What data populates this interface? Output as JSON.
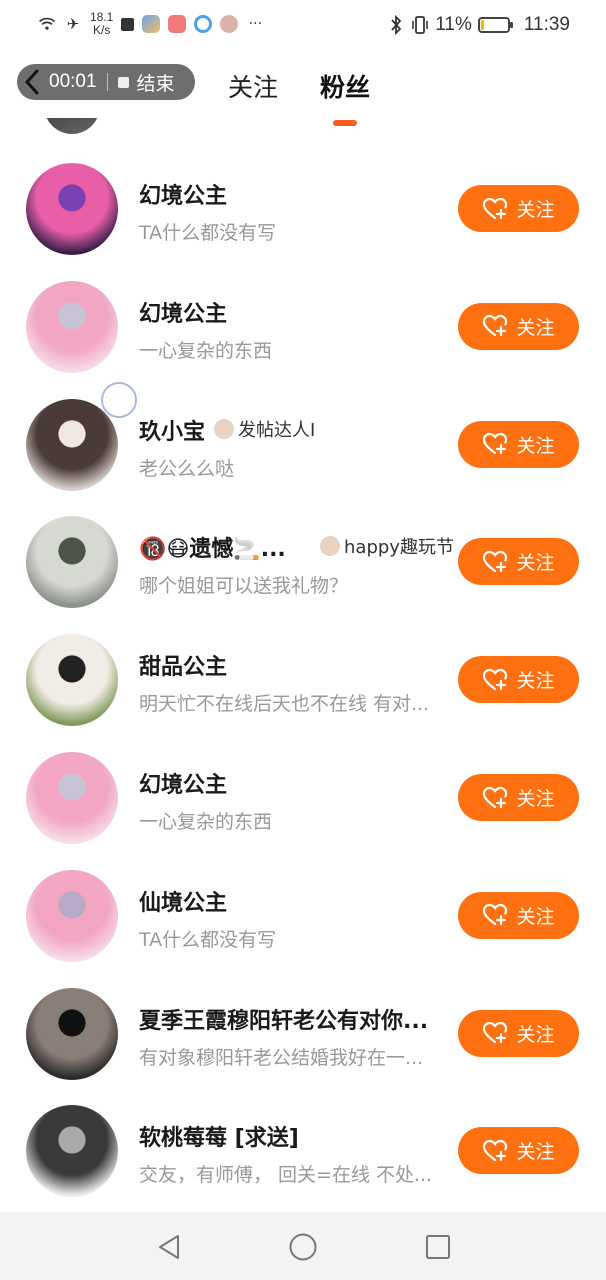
{
  "status_bar": {
    "network_speed": "18.1",
    "network_speed_unit": "K/s",
    "battery_percent": "11%",
    "time": "11:39",
    "battery_level": 0.11,
    "icons": [
      "wifi-icon",
      "airplane-icon",
      "notification-icon",
      "app-icon",
      "app-icon",
      "app-icon",
      "app-icon",
      "more-icon",
      "bluetooth-icon",
      "vibrate-icon",
      "battery-icon"
    ]
  },
  "recorder": {
    "elapsed": "00:01",
    "stop_label": "结束"
  },
  "tabs": [
    {
      "label": "关注",
      "active": false
    },
    {
      "label": "粉丝",
      "active": true
    }
  ],
  "accent_color": "#ff7010",
  "follow_label": "关注",
  "followers": [
    {
      "name": "幻境公主",
      "bio": "TA什么都没有写",
      "badge": "",
      "avatar_colors": [
        "#3a1f4a",
        "#e85fa8",
        "#7a3fb0"
      ]
    },
    {
      "name": "幻境公主",
      "bio": "一心复杂的东西",
      "badge": "",
      "avatar_colors": [
        "#f6dbe6",
        "#f2a6c4",
        "#c9c3d8"
      ]
    },
    {
      "name": "玖小宝",
      "bio": "老公么么哒",
      "badge": "发帖达人I",
      "avatar_colors": [
        "#d9cfcc",
        "#4a3a38",
        "#f0e6e2"
      ]
    },
    {
      "name": "🔞😷遗憾🚬...",
      "bio": "哪个姐姐可以送我礼物？",
      "badge": "happy趣玩节",
      "avatar_colors": [
        "#8b9088",
        "#d6d8d2",
        "#4e544a"
      ]
    },
    {
      "name": "甜品公主",
      "bio": "明天忙不在线后天也不在线 有对...",
      "badge": "",
      "avatar_colors": [
        "#7f9a5a",
        "#f1ece6",
        "#222222"
      ]
    },
    {
      "name": "幻境公主",
      "bio": "一心复杂的东西",
      "badge": "",
      "avatar_colors": [
        "#f6dbe6",
        "#f2a6c4",
        "#c9c3d8"
      ]
    },
    {
      "name": "仙境公主",
      "bio": "TA什么都没有写",
      "badge": "",
      "avatar_colors": [
        "#f6dbe6",
        "#f2a6c4",
        "#b7aac7"
      ]
    },
    {
      "name": "夏季王霞穆阳轩老公有对你...",
      "bio": "有对象穆阳轩老公结婚我好在一...",
      "badge": "",
      "avatar_colors": [
        "#2a2a2a",
        "#8a7e78",
        "#111111"
      ]
    },
    {
      "name": "软桃莓莓 [求送]",
      "bio": "交友，有师傅， 回关=在线 不处...",
      "badge": "",
      "avatar_colors": [
        "#e8e8e8",
        "#3a3a3a",
        "#a9a9a9"
      ]
    }
  ]
}
